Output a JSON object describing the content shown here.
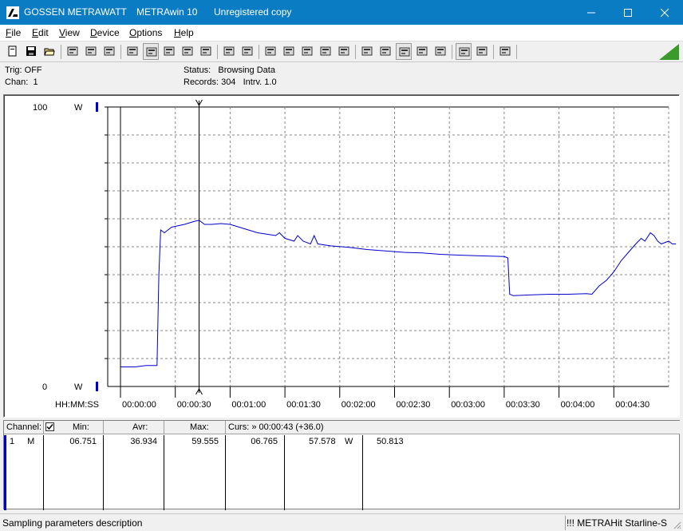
{
  "titlebar": {
    "company": "GOSSEN METRAWATT",
    "app_name": "METRAwin 10",
    "license": "Unregistered copy",
    "title_color": "#0a7cc4"
  },
  "menu": {
    "items": [
      {
        "key": "F",
        "rest": "ile"
      },
      {
        "key": "E",
        "rest": "dit"
      },
      {
        "key": "V",
        "rest": "iew"
      },
      {
        "key": "D",
        "rest": "evice"
      },
      {
        "key": "O",
        "rest": "ptions"
      },
      {
        "key": "H",
        "rest": "elp"
      }
    ]
  },
  "toolbar": {
    "buttons": [
      {
        "name": "new-icon",
        "pressed": false
      },
      {
        "name": "save-icon",
        "pressed": false
      },
      {
        "name": "open-folder-icon",
        "pressed": false
      },
      {
        "name": "device-connect-icon",
        "pressed": false
      },
      {
        "name": "device-read-icon",
        "pressed": false
      },
      {
        "name": "device-setup-icon",
        "pressed": false
      },
      {
        "name": "keyboard-icon",
        "pressed": false
      },
      {
        "name": "graph-view-icon",
        "pressed": true
      },
      {
        "name": "crosshair-icon",
        "pressed": false
      },
      {
        "name": "table-view-icon",
        "pressed": false
      },
      {
        "name": "bar-view-icon",
        "pressed": false
      },
      {
        "name": "export-icon",
        "pressed": false
      },
      {
        "name": "multi-window-icon",
        "pressed": false
      },
      {
        "name": "list-icon",
        "pressed": false
      },
      {
        "name": "monitor-icon",
        "pressed": false
      },
      {
        "name": "function-icon",
        "pressed": false
      },
      {
        "name": "channel-icon",
        "pressed": false
      },
      {
        "name": "trigger-icon",
        "pressed": false
      },
      {
        "name": "signal-icon",
        "pressed": false
      },
      {
        "name": "record-icon",
        "pressed": false
      },
      {
        "name": "alarm-icon",
        "pressed": true
      },
      {
        "name": "print-icon",
        "pressed": false
      },
      {
        "name": "print-preview-icon",
        "pressed": false
      },
      {
        "name": "zoom-wave-icon",
        "pressed": true
      },
      {
        "name": "zoom-search-icon",
        "pressed": false
      },
      {
        "name": "comment-icon",
        "pressed": false
      }
    ],
    "signal_color": "#3a9a2a"
  },
  "info": {
    "trig": "Trig: OFF",
    "chan": "Chan:  1",
    "status": "Status:   Browsing Data",
    "records": "Records: 304   Intrv. 1.0"
  },
  "chart_data": {
    "type": "line",
    "xlabel": "HH:MM:SS",
    "ylabel_top": "100",
    "ylabel_bottom": "0",
    "unit_top": "W",
    "unit_bottom": "W",
    "ylim": [
      0,
      100
    ],
    "xlim": [
      0,
      304
    ],
    "tick_labels": [
      "00:00:00",
      "00:00:30",
      "00:01:00",
      "00:01:30",
      "00:02:00",
      "00:02:30",
      "00:03:00",
      "00:03:30",
      "00:04:00",
      "00:04:30"
    ],
    "tick_seconds": [
      0,
      30,
      60,
      90,
      120,
      150,
      180,
      210,
      240,
      270
    ],
    "grid": true,
    "cursor_x": 43,
    "series": [
      {
        "color": "#0000cc",
        "points": [
          [
            0,
            7
          ],
          [
            8,
            7
          ],
          [
            14,
            7.5
          ],
          [
            20,
            7.5
          ],
          [
            21,
            40
          ],
          [
            22,
            56
          ],
          [
            24,
            55
          ],
          [
            26,
            56
          ],
          [
            28,
            57
          ],
          [
            35,
            58
          ],
          [
            40,
            59
          ],
          [
            43,
            59.5
          ],
          [
            46,
            58
          ],
          [
            50,
            58
          ],
          [
            55,
            58.3
          ],
          [
            60,
            58
          ],
          [
            65,
            57
          ],
          [
            70,
            56
          ],
          [
            75,
            55
          ],
          [
            80,
            54.5
          ],
          [
            85,
            54
          ],
          [
            87,
            55
          ],
          [
            90,
            53
          ],
          [
            95,
            52
          ],
          [
            97,
            54
          ],
          [
            100,
            52
          ],
          [
            104,
            51
          ],
          [
            106,
            54
          ],
          [
            108,
            51
          ],
          [
            115,
            50.3
          ],
          [
            125,
            49.8
          ],
          [
            135,
            49
          ],
          [
            145,
            48.5
          ],
          [
            155,
            48
          ],
          [
            165,
            47.8
          ],
          [
            175,
            47.3
          ],
          [
            185,
            47
          ],
          [
            195,
            46.8
          ],
          [
            210,
            46.5
          ],
          [
            212,
            46
          ],
          [
            213,
            33
          ],
          [
            215,
            32.5
          ],
          [
            225,
            32.8
          ],
          [
            235,
            33
          ],
          [
            245,
            33
          ],
          [
            255,
            33.2
          ],
          [
            258,
            33
          ],
          [
            262,
            36
          ],
          [
            266,
            38
          ],
          [
            270,
            41
          ],
          [
            272,
            43
          ],
          [
            274,
            45
          ],
          [
            278,
            48
          ],
          [
            282,
            51
          ],
          [
            285,
            53
          ],
          [
            287,
            52
          ],
          [
            290,
            55
          ],
          [
            292,
            54
          ],
          [
            294,
            52
          ],
          [
            296,
            51
          ],
          [
            300,
            52
          ],
          [
            302,
            51
          ],
          [
            304,
            51
          ]
        ]
      }
    ]
  },
  "table": {
    "headers": {
      "channel": "Channel:",
      "min": "Min:",
      "avr": "Avr:",
      "max": "Max:",
      "cursor": "Curs: » 00:00:43 (+36.0)"
    },
    "row": {
      "num": "1",
      "mode": "M",
      "min": "06.751",
      "avr": "36.934",
      "max": "59.555",
      "cur_val": "06.765",
      "value": "57.578",
      "unit": "W",
      "extra": "50.813"
    }
  },
  "statusbar": {
    "left": "Sampling parameters description",
    "right": "!!! METRAHit Starline-S"
  }
}
